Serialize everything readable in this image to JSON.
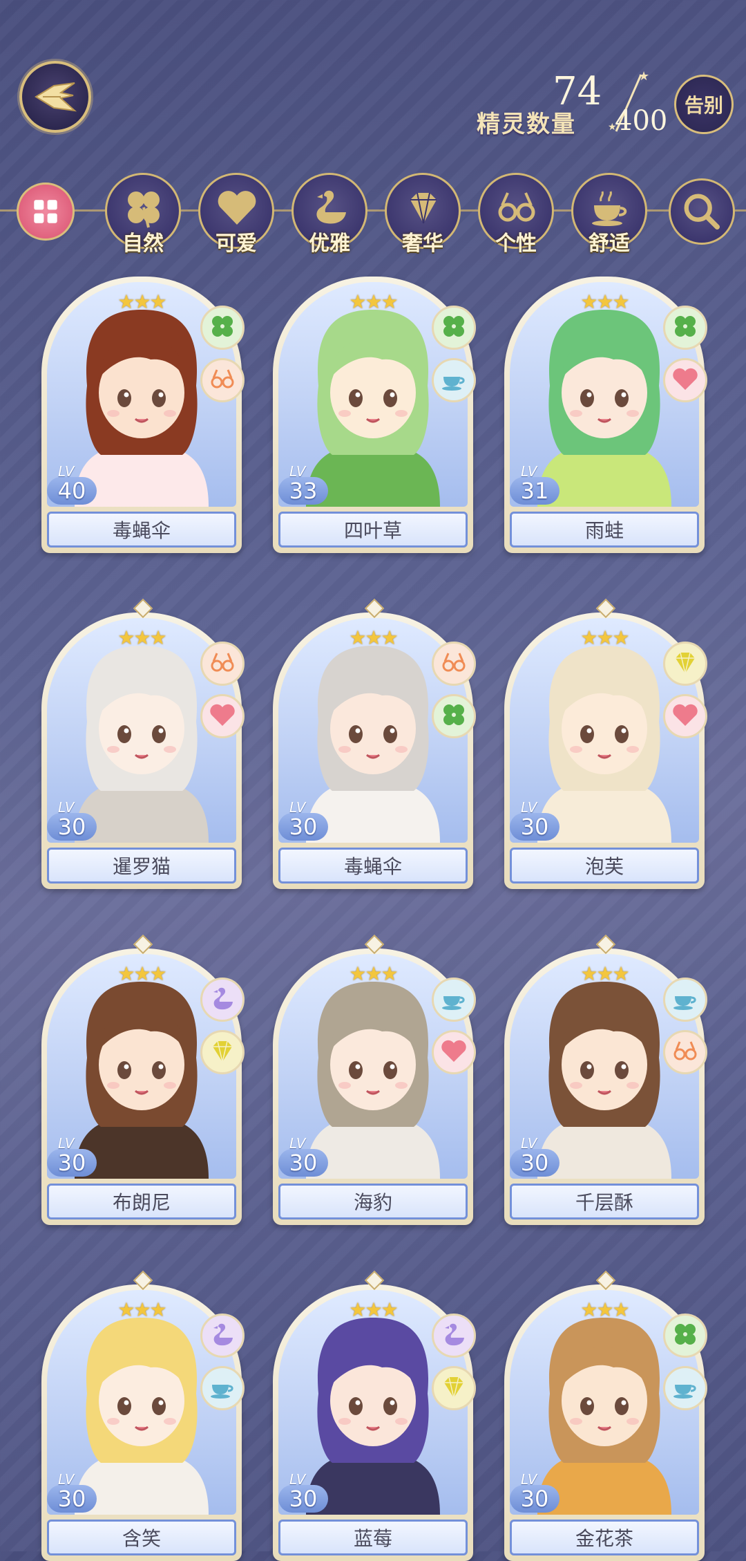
{
  "header": {
    "count_label": "精灵数量",
    "count_current": "74",
    "count_max": "400",
    "farewell_label": "告别"
  },
  "filters": [
    {
      "key": "all",
      "label": "",
      "icon": "grid-icon"
    },
    {
      "key": "nature",
      "label": "自然",
      "icon": "clover-icon"
    },
    {
      "key": "cute",
      "label": "可爱",
      "icon": "heart-icon"
    },
    {
      "key": "elegant",
      "label": "优雅",
      "icon": "swan-icon"
    },
    {
      "key": "luxury",
      "label": "奢华",
      "icon": "diamond-icon"
    },
    {
      "key": "individual",
      "label": "个性",
      "icon": "glasses-icon"
    },
    {
      "key": "comfort",
      "label": "舒适",
      "icon": "teacup-icon"
    },
    {
      "key": "search",
      "label": "",
      "icon": "search-icon"
    }
  ],
  "lv_tag": "LV",
  "spirits": [
    {
      "name": "毒蝇伞",
      "level": "40",
      "stars": "★★★",
      "traits": [
        "nature",
        "individual"
      ],
      "hair": "#8a3a22",
      "skin": "#fbe2cf",
      "cloth": "#fde9ea"
    },
    {
      "name": "四叶草",
      "level": "33",
      "stars": "★★★",
      "traits": [
        "nature",
        "comfort"
      ],
      "hair": "#a7d98a",
      "skin": "#fcecd8",
      "cloth": "#6bb654"
    },
    {
      "name": "雨蛙",
      "level": "31",
      "stars": "★★★",
      "traits": [
        "nature",
        "cute"
      ],
      "hair": "#6cc57a",
      "skin": "#fbe8da",
      "cloth": "#c9e77a"
    },
    {
      "name": "暹罗猫",
      "level": "30",
      "stars": "★★★",
      "traits": [
        "individual",
        "cute"
      ],
      "hair": "#e9e6e2",
      "skin": "#fbeee4",
      "cloth": "#d7d1c9"
    },
    {
      "name": "毒蝇伞",
      "level": "30",
      "stars": "★★★",
      "traits": [
        "individual",
        "nature"
      ],
      "hair": "#d7d3cf",
      "skin": "#fbe8dc",
      "cloth": "#f5f2ee"
    },
    {
      "name": "泡芙",
      "level": "30",
      "stars": "★★★",
      "traits": [
        "luxury",
        "cute"
      ],
      "hair": "#efe3c8",
      "skin": "#fcebd9",
      "cloth": "#f7ecd8"
    },
    {
      "name": "布朗尼",
      "level": "30",
      "stars": "★★★",
      "traits": [
        "elegant",
        "luxury"
      ],
      "hair": "#7a4a30",
      "skin": "#fbe4d2",
      "cloth": "#4c3529"
    },
    {
      "name": "海豹",
      "level": "30",
      "stars": "★★★",
      "traits": [
        "comfort",
        "cute"
      ],
      "hair": "#b0a592",
      "skin": "#fbe9dc",
      "cloth": "#eeeae4"
    },
    {
      "name": "千层酥",
      "level": "30",
      "stars": "★★★",
      "traits": [
        "comfort",
        "individual"
      ],
      "hair": "#7b5238",
      "skin": "#fbe6d4",
      "cloth": "#efe8de"
    },
    {
      "name": "含笑",
      "level": "30",
      "stars": "★★★",
      "traits": [
        "elegant",
        "comfort"
      ],
      "hair": "#f4d879",
      "skin": "#fcede0",
      "cloth": "#f4f0ea"
    },
    {
      "name": "蓝莓",
      "level": "30",
      "stars": "★★★",
      "traits": [
        "elegant",
        "luxury"
      ],
      "hair": "#5a4aa2",
      "skin": "#fbe6da",
      "cloth": "#3a3760"
    },
    {
      "name": "金花茶",
      "level": "30",
      "stars": "★★★",
      "traits": [
        "nature",
        "comfort"
      ],
      "hair": "#c9955a",
      "skin": "#fbe6d2",
      "cloth": "#e9a84a"
    }
  ]
}
